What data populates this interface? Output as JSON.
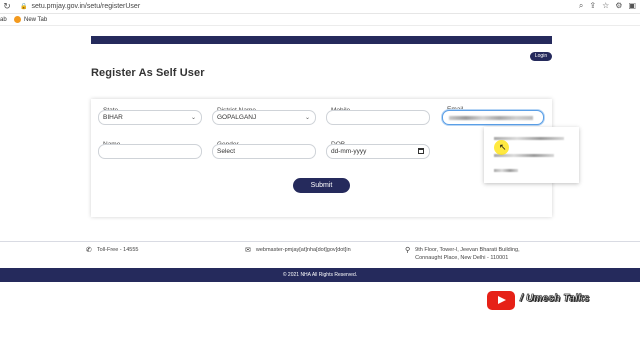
{
  "browser": {
    "url": "setu.pmjay.gov.in/setu/registerUser",
    "bookmarks": [
      "ab",
      "New Tab"
    ]
  },
  "header": {
    "login_label": "Login",
    "page_title": "Register As Self User"
  },
  "form": {
    "state_label": "State",
    "state_value": "BIHAR",
    "district_label": "District Name",
    "district_value": "GOPALGANJ",
    "mobile_label": "Mobile",
    "email_label": "Email",
    "name_label": "Name",
    "gender_label": "Gender",
    "gender_value": "Select",
    "dob_label": "DOB",
    "dob_value": "dd-mm-yyyy",
    "submit_label": "Submit"
  },
  "footer": {
    "tollfree": "Toll-Free - 14555",
    "email": "webmaster-pmjay[at]nha[dot]gov[dot]in",
    "address_line1": "9th Floor, Tower-l, Jeevan Bharati Building,",
    "address_line2": "Connaught Place, New Delhi - 110001",
    "copyright": "© 2021 NHA All Rights Reserved."
  },
  "watermark": {
    "text": "/ Umesh Talks"
  },
  "colors": {
    "brand_navy": "#252a5c",
    "youtube_red": "#e62117"
  }
}
